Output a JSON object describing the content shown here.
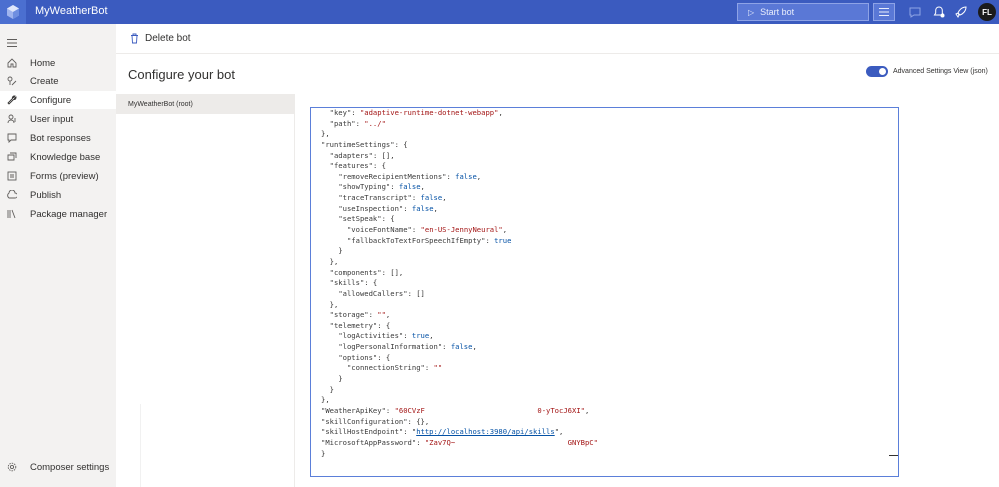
{
  "app": {
    "title": "MyWeatherBot",
    "user_initials": "FL",
    "accent": "#3b5bbf"
  },
  "topbar": {
    "start_bot_label": "Start bot",
    "icons": [
      "composer-logo-icon",
      "play-icon",
      "menu-icon",
      "chat-icon",
      "notifications-icon",
      "rocket-icon"
    ]
  },
  "nav": {
    "items": [
      {
        "label": "Home",
        "icon": "home-icon"
      },
      {
        "label": "Create",
        "icon": "create-icon"
      },
      {
        "label": "Configure",
        "icon": "wrench-icon"
      },
      {
        "label": "User input",
        "icon": "user-input-icon"
      },
      {
        "label": "Bot responses",
        "icon": "bot-responses-icon"
      },
      {
        "label": "Knowledge base",
        "icon": "knowledge-base-icon"
      },
      {
        "label": "Forms (preview)",
        "icon": "forms-icon"
      },
      {
        "label": "Publish",
        "icon": "publish-icon"
      },
      {
        "label": "Package manager",
        "icon": "package-manager-icon"
      }
    ],
    "active": "Configure",
    "bottom": {
      "label": "Composer settings",
      "icon": "gear-icon"
    }
  },
  "toolbar": {
    "delete_label": "Delete bot"
  },
  "page": {
    "title": "Configure your bot",
    "toggle_label": "Advanced Settings View (json)",
    "toggle_on": true
  },
  "bots": {
    "selected": "MyWeatherBot (root)"
  },
  "editor": {
    "lines": [
      "  \"key\": \"adaptive-runtime-dotnet-webapp\",",
      "  \"path\": \"../\"",
      "},",
      "\"runtimeSettings\": {",
      "  \"adapters\": [],",
      "  \"features\": {",
      "    \"removeRecipientMentions\": false,",
      "    \"showTyping\": false,",
      "    \"traceTranscript\": false,",
      "    \"useInspection\": false,",
      "    \"setSpeak\": {",
      "      \"voiceFontName\": \"en-US-JennyNeural\",",
      "      \"fallbackToTextForSpeechIfEmpty\": true",
      "    }",
      "  },",
      "  \"components\": [],",
      "  \"skills\": {",
      "    \"allowedCallers\": []",
      "  },",
      "  \"storage\": \"\",",
      "  \"telemetry\": {",
      "    \"logActivities\": true,",
      "    \"logPersonalInformation\": false,",
      "    \"options\": {",
      "      \"connectionString\": \"\"",
      "    }",
      "  }",
      "},",
      "\"WeatherApiKey\": \"60CVzF                          0-yTocJ6XI\",",
      "\"skillConfiguration\": {},",
      "\"skillHostEndpoint\": \"http://localhost:3980/api/skills\",",
      "\"MicrosoftAppPassword\": \"Zav7Q~                          GNYBpC\"",
      "}"
    ]
  }
}
